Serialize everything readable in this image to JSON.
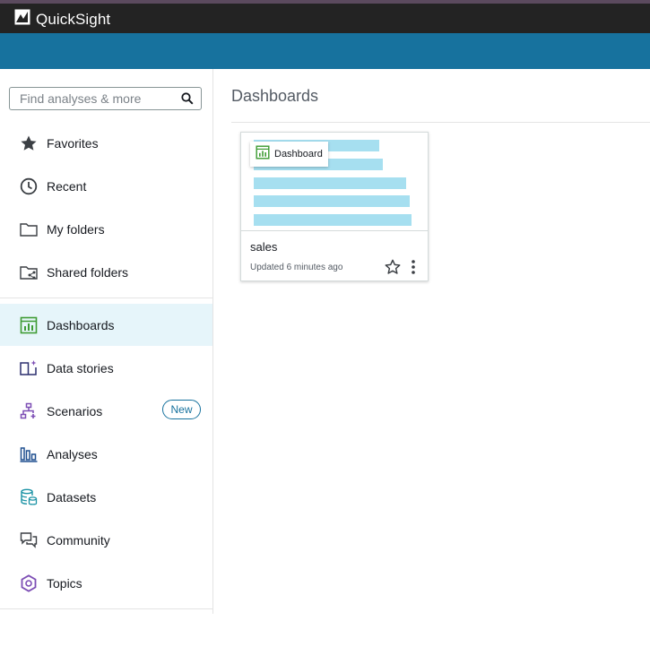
{
  "app": {
    "name": "QuickSight"
  },
  "search": {
    "placeholder": "Find analyses & more"
  },
  "sidebar": {
    "items": [
      {
        "label": "Favorites",
        "icon": "star-icon"
      },
      {
        "label": "Recent",
        "icon": "clock-icon"
      },
      {
        "label": "My folders",
        "icon": "folder-icon"
      },
      {
        "label": "Shared folders",
        "icon": "shared-folder-icon"
      },
      {
        "label": "Dashboards",
        "icon": "dashboard-icon",
        "active": true
      },
      {
        "label": "Data stories",
        "icon": "book-icon"
      },
      {
        "label": "Scenarios",
        "icon": "hierarchy-icon",
        "badge": "New"
      },
      {
        "label": "Analyses",
        "icon": "analyses-icon"
      },
      {
        "label": "Datasets",
        "icon": "database-icon"
      },
      {
        "label": "Community",
        "icon": "chat-icon"
      },
      {
        "label": "Topics",
        "icon": "hexagon-icon"
      }
    ]
  },
  "main": {
    "title": "Dashboards",
    "cards": [
      {
        "type_label": "Dashboard",
        "name": "sales",
        "updated": "Updated 6 minutes ago"
      }
    ]
  },
  "colors": {
    "top_bar": "#232323",
    "brand_bar": "#17729e",
    "active_bg": "#e6f5fa",
    "thumb_bar": "#a6dff0",
    "dashboard_green": "#3f9c35",
    "purple": "#7d4eb5",
    "navy": "#1f4f8f",
    "teal": "#1b93a5"
  }
}
